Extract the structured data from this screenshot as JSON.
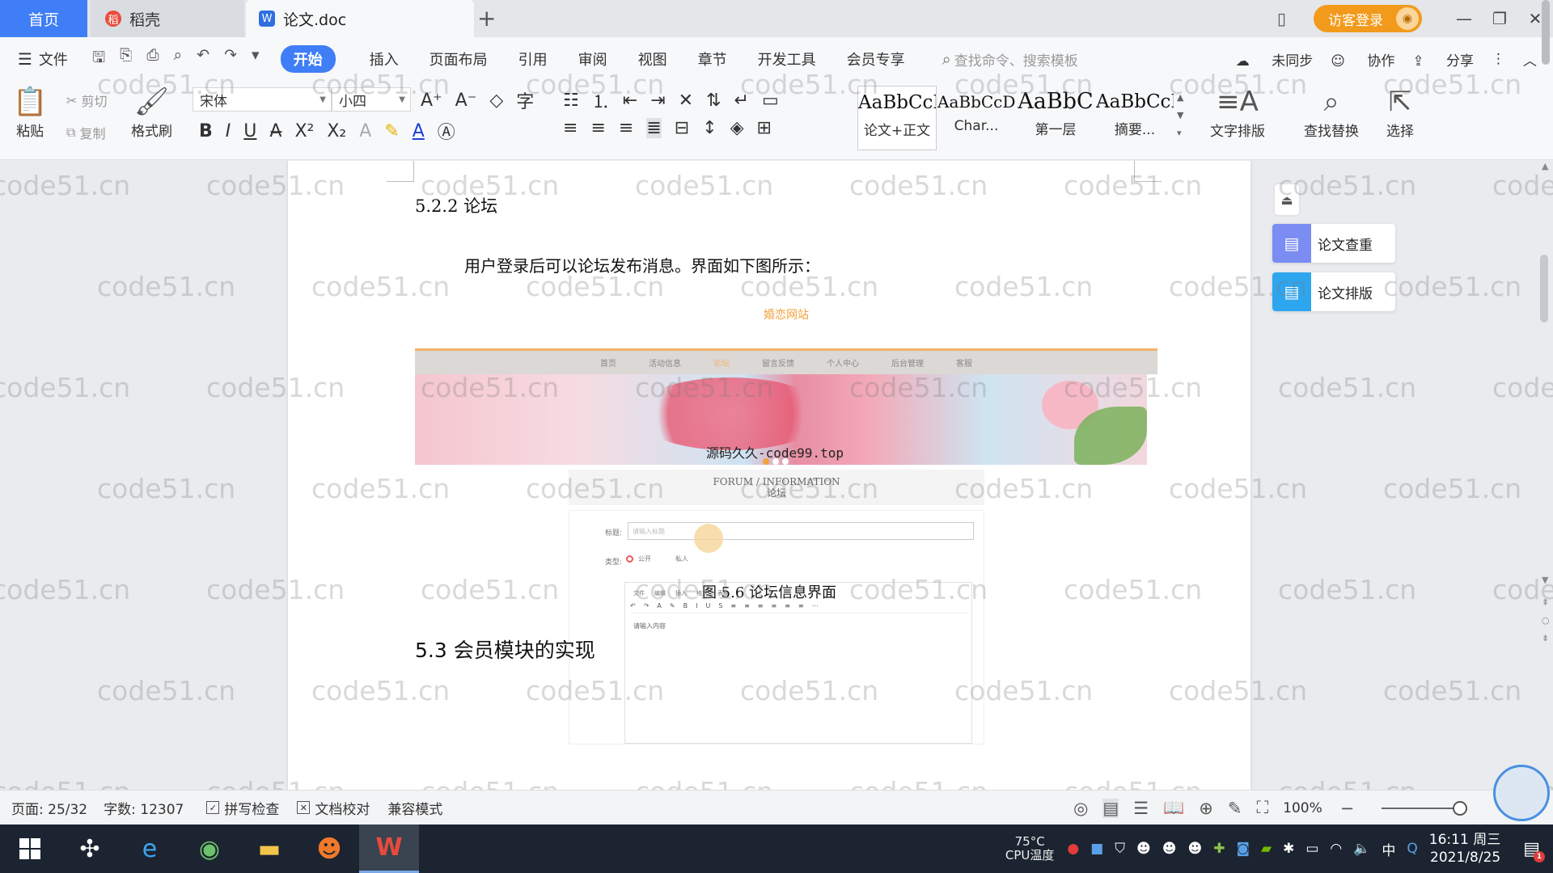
{
  "tabs": {
    "home": "首页",
    "daoke": "稻壳",
    "doc": "论文.doc",
    "add": "+"
  },
  "window": {
    "login": "访客登录"
  },
  "menu": {
    "file": "文件",
    "tabs": [
      "开始",
      "插入",
      "页面布局",
      "引用",
      "审阅",
      "视图",
      "章节",
      "开发工具",
      "会员专享"
    ],
    "search_placeholder": "查找命令、搜索模板",
    "sync": "未同步",
    "collab": "协作",
    "share": "分享"
  },
  "ribbon": {
    "paste": "粘贴",
    "cut": "剪切",
    "copy": "复制",
    "format_painter": "格式刷",
    "font_name": "宋体",
    "font_size": "小四",
    "styles": [
      {
        "preview": "AaBbCcI",
        "label": "论文+正文"
      },
      {
        "preview": "AaBbCcDc",
        "label": "Char..."
      },
      {
        "preview": "AaBbC",
        "label": "第一层"
      },
      {
        "preview": "AaBbCcI",
        "label": "摘要..."
      }
    ],
    "text_layout": "文字排版",
    "find_replace": "查找替换",
    "select": "选择"
  },
  "document": {
    "heading": "5.2.2  论坛",
    "paragraph": "用户登录后可以论坛发布消息。界面如下图所示：",
    "figure": {
      "site_title": "婚恋网站",
      "nav": [
        "首页",
        "活动信息",
        "论坛",
        "留言反馈",
        "个人中心",
        "后台管理",
        "客服"
      ],
      "banner_watermark": "源码久久-code99.top",
      "forum_en": "FORUM / INFORMATION",
      "forum_cn": "论坛",
      "title_label": "标题:",
      "title_placeholder": "请输入标题",
      "type_label": "类型:",
      "type_public": "公开",
      "type_private": "私人",
      "editor_menu": [
        "文件",
        "编辑",
        "插入",
        "格式",
        "表格"
      ],
      "editor_tools": [
        "↶",
        "↷",
        "A",
        "✎",
        "B",
        "I",
        "U",
        "S",
        "≡",
        "≡",
        "≡",
        "≡",
        "≡",
        "≡",
        "⋯"
      ],
      "editor_placeholder": "请输入内容"
    },
    "caption": "图 5.6  论坛信息界面",
    "heading2": "5.3  会员模块的实现"
  },
  "side_panel": {
    "check": "论文查重",
    "layout": "论文排版"
  },
  "watermark": "code51.cn",
  "status": {
    "page": "页面: 25/32",
    "words": "字数: 12307",
    "spell": "拼写检查",
    "proof": "文档校对",
    "compat": "兼容模式",
    "zoom": "100%"
  },
  "taskbar": {
    "cpu_temp": "75°C",
    "cpu_label": "CPU温度",
    "ime": "中",
    "time": "16:11 周三",
    "date": "2021/8/25",
    "notif_count": "1"
  },
  "colors": {
    "accent": "#3f7ef6",
    "login": "#f29a1b"
  }
}
